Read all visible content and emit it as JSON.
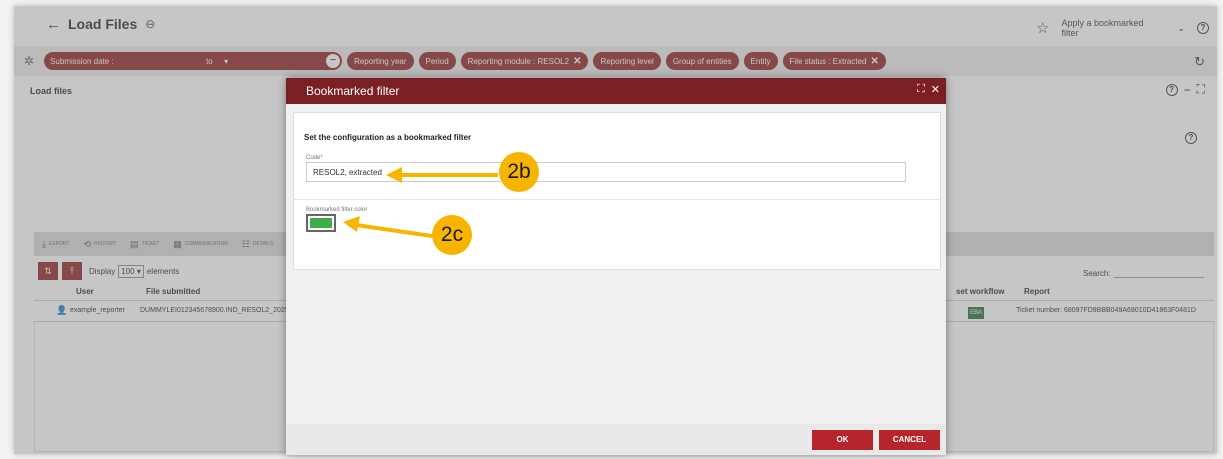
{
  "header": {
    "title": "Load Files",
    "bookmark_select": "Apply a bookmarked filter"
  },
  "filters": {
    "date_label": "Submission date :",
    "date_to": "to",
    "chips": [
      {
        "label": "Reporting year",
        "removable": false
      },
      {
        "label": "Period",
        "removable": false
      },
      {
        "label": "Reporting module : RESOL2",
        "removable": true
      },
      {
        "label": "Reporting level",
        "removable": false
      },
      {
        "label": "Group of entities",
        "removable": false
      },
      {
        "label": "Entity",
        "removable": false
      },
      {
        "label": "File status : Extracted",
        "removable": true
      }
    ]
  },
  "panel": {
    "title": "Load files",
    "toolbar": [
      "EXPORT",
      "HISTORY",
      "TICKET",
      "COMMUNICATION",
      "DETAILS"
    ],
    "display_label": "Display",
    "display_value": "100",
    "elements_label": "elements",
    "search_label": "Search:"
  },
  "table": {
    "headers": {
      "user": "User",
      "file": "File submitted",
      "workflow": "set workflow",
      "report": "Report"
    },
    "rows": [
      {
        "user": "example_reporter",
        "file": "DUMMYLEI012345678900.IND_RESOL2_2025-12-31_",
        "workflow": "EBA",
        "report": "Ticket number: 68097FD9BBB049A69010D41863F0481D"
      }
    ]
  },
  "modal": {
    "title": "Bookmarked filter",
    "subtitle": "Set the configuration as a bookmarked filter",
    "code_label": "Code*",
    "code_value": "RESOL2, extracted",
    "color_label": "Bookmarked filter color",
    "color_value": "#3fae4a",
    "ok": "OK",
    "cancel": "CANCEL"
  },
  "callouts": {
    "a": "2b",
    "b": "2c"
  },
  "colors": {
    "brand": "#8b1a1a",
    "modal_header": "#7b1f23",
    "button": "#b7252c",
    "callout": "#f7b500"
  }
}
